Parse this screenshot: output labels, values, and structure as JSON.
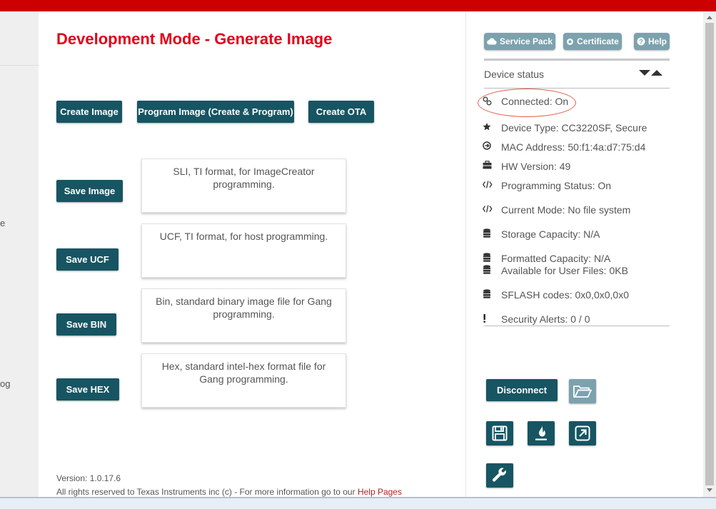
{
  "page": {
    "title": "Development Mode - Generate Image",
    "left_fragments": [
      "e",
      "og"
    ]
  },
  "actions": {
    "create_image": "Create Image",
    "program_image": "Program Image (Create & Program)",
    "create_ota": "Create  OTA"
  },
  "save_options": [
    {
      "label": "Save Image",
      "description": "SLI, TI format, for ImageCreator programming."
    },
    {
      "label": "Save UCF",
      "description": "UCF, TI format, for host programming."
    },
    {
      "label": "Save BIN",
      "description": "Bin, standard binary image file for Gang programming."
    },
    {
      "label": "Save HEX",
      "description": "Hex, standard intel-hex format file for Gang programming."
    }
  ],
  "footer": {
    "version": "Version: 1.0.17.6",
    "rights": "All rights reserved to Texas Instruments inc (c) - For more information go to our ",
    "help_link": "Help Pages"
  },
  "top_buttons": {
    "service_pack": "Service Pack",
    "certificate": "Certificate",
    "help": "Help"
  },
  "device_status": {
    "title": "Device status",
    "connected": "Connected: On",
    "device_type": "Device Type: CC3220SF, Secure",
    "mac": "MAC Address: 50:f1:4a:d7:75:d4",
    "hw_version": "HW Version: 49",
    "programming_status": "Programming Status: On",
    "current_mode": "Current Mode: No file system",
    "storage_capacity": "Storage Capacity: N/A",
    "formatted_capacity": "Formatted Capacity: N/A",
    "available_user_files": "Available for User Files: 0KB",
    "sflash_codes": "SFLASH codes: 0x0,0x0,0x0",
    "security_alerts": "Security Alerts: 0 / 0"
  },
  "controls": {
    "disconnect": "Disconnect"
  },
  "colors": {
    "brand_red": "#cc0000",
    "title_red": "#e1001a",
    "button_teal": "#175563",
    "button_light": "#7ca2ae",
    "annotation_circle": "#e05a4a"
  },
  "icons": {
    "connected": "link-icon",
    "device_type": "star-icon",
    "mac": "arrow-circle-icon",
    "hw_version": "briefcase-icon",
    "programming_status": "code-icon",
    "current_mode": "code-icon",
    "storage": "database-icon",
    "security": "exclamation-icon",
    "open": "folder-open-icon",
    "save": "floppy-disk-icon",
    "burn": "flame-icon",
    "external": "external-link-icon",
    "settings": "wrench-icon"
  }
}
